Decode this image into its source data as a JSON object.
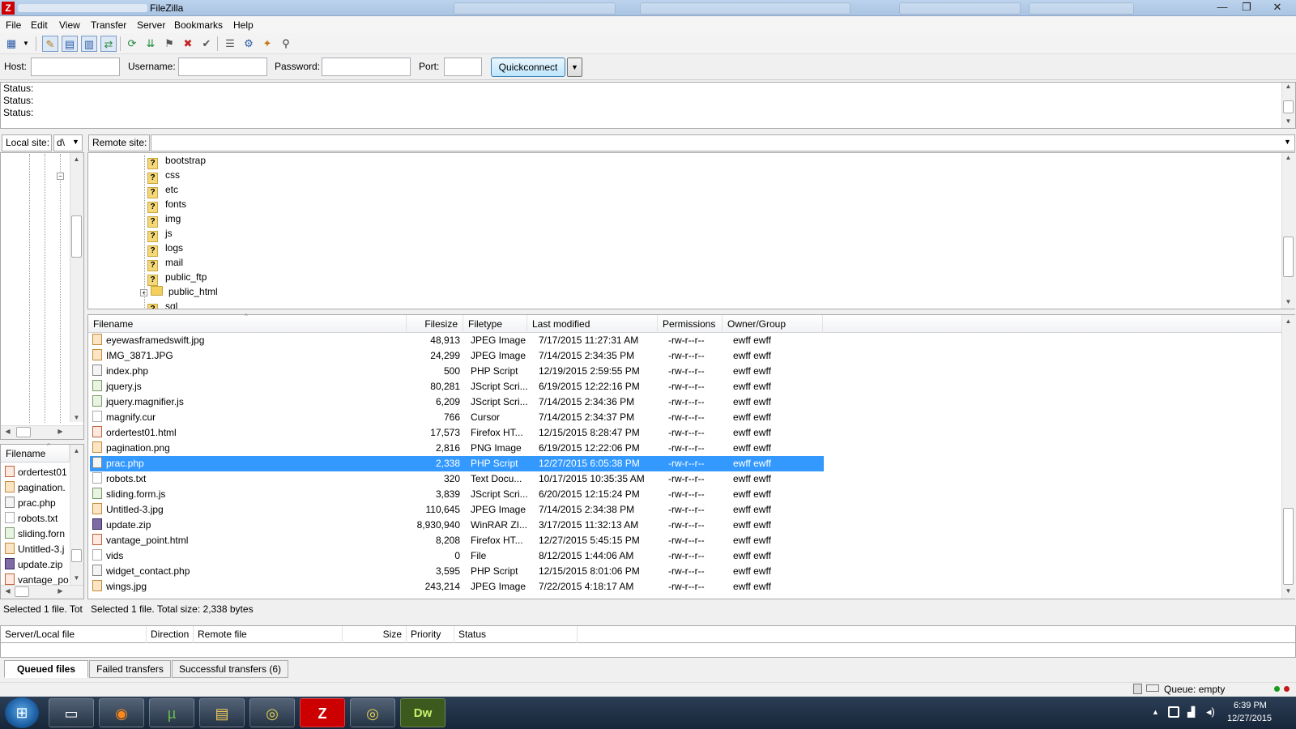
{
  "window": {
    "title": "FileZilla",
    "logo_letter": "Z",
    "min": "—",
    "max": "❐",
    "close": "✕"
  },
  "menu": [
    "File",
    "Edit",
    "View",
    "Transfer",
    "Server",
    "Bookmarks",
    "Help"
  ],
  "toolbar_icons": [
    "site-manager-icon",
    "dropdown-arrow-icon",
    "toggle-log-icon",
    "toggle-tree-icon",
    "toggle-remote-tree-icon",
    "toggle-queue-icon",
    "refresh-icon",
    "process-queue-icon",
    "cancel-icon",
    "disconnect-icon",
    "reconnect-icon",
    "filter-icon",
    "compare-icon",
    "sync-browse-icon",
    "search-icon"
  ],
  "quickconnect": {
    "host_label": "Host:",
    "host_value": "",
    "username_label": "Username:",
    "username_value": "",
    "password_label": "Password:",
    "password_value": "",
    "port_label": "Port:",
    "port_value": "",
    "button": "Quickconnect",
    "dropdown": "▼"
  },
  "log": [
    "Status:",
    "Status:",
    "Status:"
  ],
  "local_site": {
    "label": "Local site:",
    "value": "d\\",
    "arrow": "▼"
  },
  "remote_site": {
    "label": "Remote site:",
    "value": "",
    "arrow": "▼"
  },
  "remote_tree": [
    {
      "name": "bootstrap",
      "icon": "question"
    },
    {
      "name": "css",
      "icon": "question"
    },
    {
      "name": "etc",
      "icon": "question"
    },
    {
      "name": "fonts",
      "icon": "question"
    },
    {
      "name": "img",
      "icon": "question"
    },
    {
      "name": "js",
      "icon": "question"
    },
    {
      "name": "logs",
      "icon": "question"
    },
    {
      "name": "mail",
      "icon": "question"
    },
    {
      "name": "public_ftp",
      "icon": "question"
    },
    {
      "name": "public_html",
      "icon": "folder",
      "expander": "+"
    },
    {
      "name": "sql",
      "icon": "question"
    }
  ],
  "local_tree_expander": "−",
  "remote_columns": {
    "filename": "Filename",
    "filesize": "Filesize",
    "filetype": "Filetype",
    "modified": "Last modified",
    "permissions": "Permissions",
    "owner": "Owner/Group",
    "sort_arrow": "^"
  },
  "remote_files": [
    {
      "name": "eyewasframedswift.jpg",
      "size": "48,913",
      "type": "JPEG Image",
      "modified": "7/17/2015 11:27:31 AM",
      "perm": "-rw-r--r--",
      "owner": "ewff ewff",
      "icon": "img"
    },
    {
      "name": "IMG_3871.JPG",
      "size": "24,299",
      "type": "JPEG Image",
      "modified": "7/14/2015 2:34:35 PM",
      "perm": "-rw-r--r--",
      "owner": "ewff ewff",
      "icon": "img"
    },
    {
      "name": "index.php",
      "size": "500",
      "type": "PHP Script",
      "modified": "12/19/2015 2:59:55 PM",
      "perm": "-rw-r--r--",
      "owner": "ewff ewff",
      "icon": "php"
    },
    {
      "name": "jquery.js",
      "size": "80,281",
      "type": "JScript Scri...",
      "modified": "6/19/2015 12:22:16 PM",
      "perm": "-rw-r--r--",
      "owner": "ewff ewff",
      "icon": "js"
    },
    {
      "name": "jquery.magnifier.js",
      "size": "6,209",
      "type": "JScript Scri...",
      "modified": "7/14/2015 2:34:36 PM",
      "perm": "-rw-r--r--",
      "owner": "ewff ewff",
      "icon": "js"
    },
    {
      "name": "magnify.cur",
      "size": "766",
      "type": "Cursor",
      "modified": "7/14/2015 2:34:37 PM",
      "perm": "-rw-r--r--",
      "owner": "ewff ewff",
      "icon": "cur"
    },
    {
      "name": "ordertest01.html",
      "size": "17,573",
      "type": "Firefox HT...",
      "modified": "12/15/2015 8:28:47 PM",
      "perm": "-rw-r--r--",
      "owner": "ewff ewff",
      "icon": "html"
    },
    {
      "name": "pagination.png",
      "size": "2,816",
      "type": "PNG Image",
      "modified": "6/19/2015 12:22:06 PM",
      "perm": "-rw-r--r--",
      "owner": "ewff ewff",
      "icon": "img"
    },
    {
      "name": "prac.php",
      "size": "2,338",
      "type": "PHP Script",
      "modified": "12/27/2015 6:05:38 PM",
      "perm": "-rw-r--r--",
      "owner": "ewff ewff",
      "icon": "php",
      "selected": true
    },
    {
      "name": "robots.txt",
      "size": "320",
      "type": "Text Docu...",
      "modified": "10/17/2015 10:35:35 AM",
      "perm": "-rw-r--r--",
      "owner": "ewff ewff",
      "icon": "txt"
    },
    {
      "name": "sliding.form.js",
      "size": "3,839",
      "type": "JScript Scri...",
      "modified": "6/20/2015 12:15:24 PM",
      "perm": "-rw-r--r--",
      "owner": "ewff ewff",
      "icon": "js"
    },
    {
      "name": "Untitled-3.jpg",
      "size": "110,645",
      "type": "JPEG Image",
      "modified": "7/14/2015 2:34:38 PM",
      "perm": "-rw-r--r--",
      "owner": "ewff ewff",
      "icon": "img"
    },
    {
      "name": "update.zip",
      "size": "8,930,940",
      "type": "WinRAR ZI...",
      "modified": "3/17/2015 11:32:13 AM",
      "perm": "-rw-r--r--",
      "owner": "ewff ewff",
      "icon": "zip"
    },
    {
      "name": "vantage_point.html",
      "size": "8,208",
      "type": "Firefox HT...",
      "modified": "12/27/2015 5:45:15 PM",
      "perm": "-rw-r--r--",
      "owner": "ewff ewff",
      "icon": "html"
    },
    {
      "name": "vids",
      "size": "0",
      "type": "File",
      "modified": "8/12/2015 1:44:06 AM",
      "perm": "-rw-r--r--",
      "owner": "ewff ewff",
      "icon": "cur"
    },
    {
      "name": "widget_contact.php",
      "size": "3,595",
      "type": "PHP Script",
      "modified": "12/15/2015 8:01:06 PM",
      "perm": "-rw-r--r--",
      "owner": "ewff ewff",
      "icon": "php"
    },
    {
      "name": "wings.jpg",
      "size": "243,214",
      "type": "JPEG Image",
      "modified": "7/22/2015 4:18:17 AM",
      "perm": "-rw-r--r--",
      "owner": "ewff ewff",
      "icon": "img"
    }
  ],
  "local_columns": {
    "filename": "Filename",
    "sort_arrow": "^"
  },
  "local_files": [
    {
      "name": "ordertest01",
      "icon": "html"
    },
    {
      "name": "pagination.",
      "icon": "img"
    },
    {
      "name": "prac.php",
      "icon": "php"
    },
    {
      "name": "robots.txt",
      "icon": "txt"
    },
    {
      "name": "sliding.forn",
      "icon": "js"
    },
    {
      "name": "Untitled-3.j",
      "icon": "img"
    },
    {
      "name": "update.zip",
      "icon": "zip"
    },
    {
      "name": "vantage_po",
      "icon": "html"
    }
  ],
  "local_status": "Selected 1 file. Tot",
  "remote_status": "Selected 1 file. Total size: 2,338 bytes",
  "queue_columns": [
    "Server/Local file",
    "Direction",
    "Remote file",
    "Size",
    "Priority",
    "Status"
  ],
  "queue_tabs": [
    "Queued files",
    "Failed transfers",
    "Successful transfers (6)"
  ],
  "statusbar": {
    "queue": "Queue: empty"
  },
  "taskbar": {
    "start": "⊞",
    "apps": [
      "explorer-icon",
      "firefox-icon",
      "utorrent-icon",
      "folder-icon",
      "chrome-icon",
      "filezilla-icon",
      "chrome-icon",
      "dreamweaver-icon"
    ],
    "app_glyphs": [
      "▭",
      "◉",
      "µ",
      "▤",
      "◎",
      "Z",
      "◎",
      "Dw"
    ],
    "clock_time": "6:39 PM",
    "clock_date": "12/27/2015",
    "tray_arrow": "▲"
  },
  "colors": {
    "selection": "#3399ff",
    "accent": "#c00000"
  }
}
